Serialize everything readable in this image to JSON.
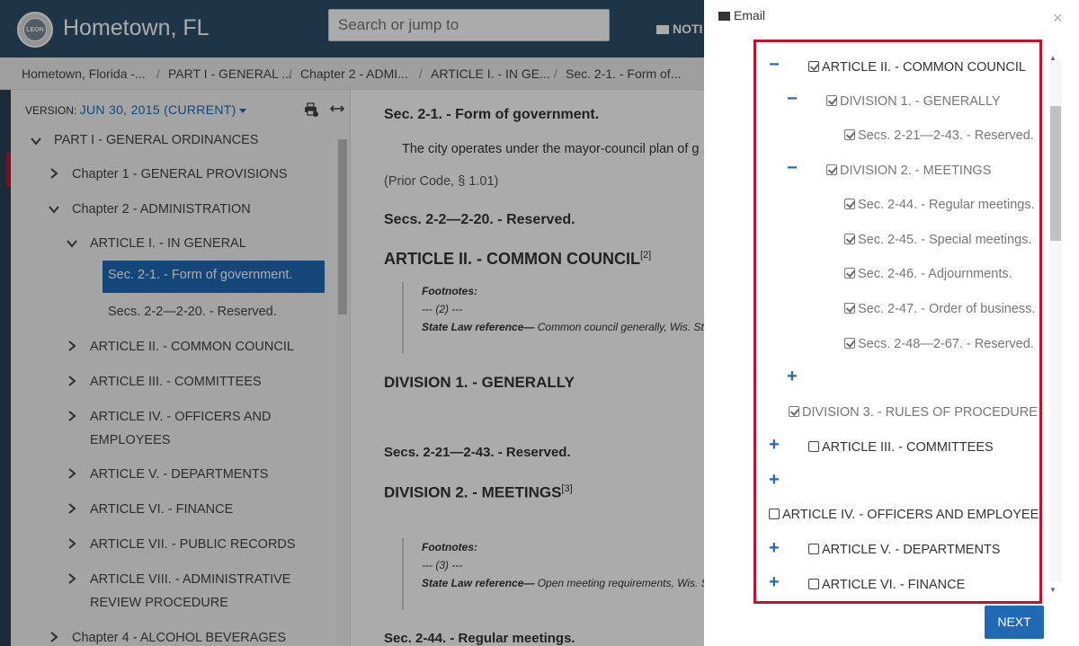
{
  "header": {
    "seal_label": "LEON",
    "site_title": "Hometown, FL",
    "search_placeholder": "Search or jump to",
    "notify_label": "NOTI"
  },
  "breadcrumb": [
    "Hometown, Florida -...",
    "PART I - GENERAL ...",
    "Chapter 2 - ADMI...",
    "ARTICLE I. - IN GE...",
    "Sec. 2-1. - Form of..."
  ],
  "breadcrumb_sep": "/",
  "sidebar": {
    "version_label": "VERSION:",
    "version_value": "JUN 30, 2015 (CURRENT)",
    "items": [
      "PART I - GENERAL ORDINANCES",
      "Chapter 1 - GENERAL PROVISIONS",
      "Chapter 2 - ADMINISTRATION",
      "ARTICLE I. - IN GENERAL",
      "Sec. 2-1. - Form of government.",
      "Secs. 2-2—2-20. - Reserved.",
      "ARTICLE II. - COMMON COUNCIL",
      "ARTICLE III. - COMMITTEES",
      "ARTICLE IV. - OFFICERS AND",
      "EMPLOYEES",
      "ARTICLE V. - DEPARTMENTS",
      "ARTICLE VI. - FINANCE",
      "ARTICLE VII. - PUBLIC RECORDS",
      "ARTICLE VIII. - ADMINISTRATIVE",
      "REVIEW PROCEDURE",
      "Chapter 4 - ALCOHOL BEVERAGES"
    ]
  },
  "content": {
    "sec21_title": "Sec. 2-1. - Form of government.",
    "sec21_text": "The city operates under the mayor-council plan of g",
    "prior_code": "(Prior Code, § 1.01)",
    "secs220": "Secs. 2-2—2-20. - Reserved.",
    "art2_title": "ARTICLE II. - COMMON COUNCIL",
    "art2_sup": "[2]",
    "fn_label": "Footnotes:",
    "fn2_num": "--- (2) ---",
    "fn2_ref_label": "State Law reference—",
    "fn2_ref_text": " Common council generally, Wis. Sta",
    "div1_title": "DIVISION 1. - GENERALLY",
    "secs221": "Secs. 2-21—2-43. - Reserved.",
    "div2_title": "DIVISION 2. - MEETINGS",
    "div2_sup": "[3]",
    "fn3_num": "--- (3) ---",
    "fn3_ref_label": "State Law reference—",
    "fn3_ref_text": " Open meeting requirements, Wis. S",
    "sec244": "Sec. 2-44. - Regular meetings."
  },
  "modal": {
    "title": "Email",
    "close": "×",
    "next_label": "NEXT",
    "tree": [
      {
        "text": "ARTICLE II. - COMMON COUNCIL",
        "checked": true
      },
      {
        "text": "DIVISION 1. - GENERALLY",
        "checked": true
      },
      {
        "text": "Secs. 2-21—2-43. - Reserved.",
        "checked": true
      },
      {
        "text": "DIVISION 2. - MEETINGS",
        "checked": true
      },
      {
        "text": "Sec. 2-44. - Regular meetings.",
        "checked": true
      },
      {
        "text": "Sec. 2-45. - Special meetings.",
        "checked": true
      },
      {
        "text": "Sec. 2-46. - Adjournments.",
        "checked": true
      },
      {
        "text": "Sec. 2-47. - Order of business.",
        "checked": true
      },
      {
        "text": "Secs. 2-48—2-67. - Reserved.",
        "checked": true
      },
      {
        "text": "DIVISION 3. - RULES OF PROCEDURE",
        "checked": true
      },
      {
        "text": "ARTICLE III. - COMMITTEES",
        "checked": false
      },
      {
        "text": "ARTICLE IV. - OFFICERS AND EMPLOYEES",
        "checked": false
      },
      {
        "text": "ARTICLE V. - DEPARTMENTS",
        "checked": false
      },
      {
        "text": "ARTICLE VI. - FINANCE",
        "checked": false
      }
    ],
    "minus": "−",
    "plus": "+"
  },
  "colors": {
    "header_bg": "#2e4e6b",
    "accent_blue": "#1f69b5",
    "highlight_red": "#c8102e"
  }
}
